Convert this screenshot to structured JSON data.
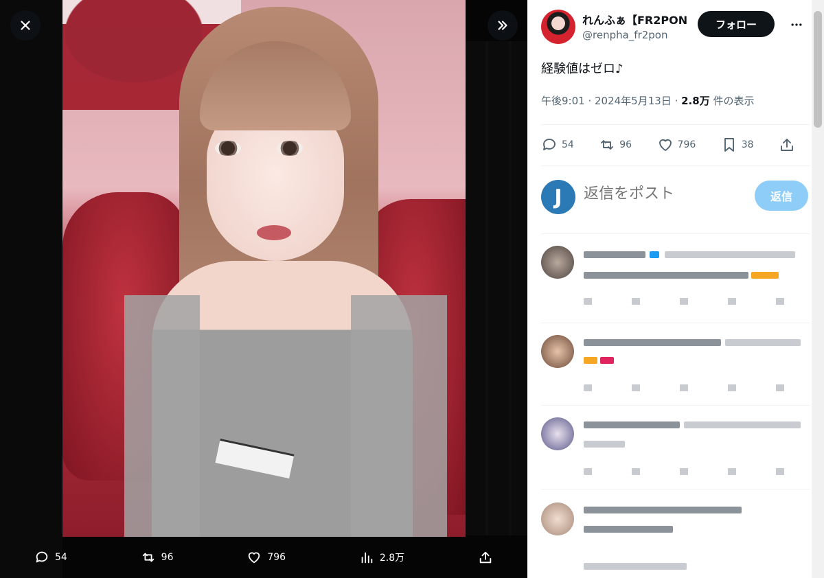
{
  "viewer": {
    "close_icon": "close-icon",
    "expand_icon": "chevron-double-right-icon",
    "actions": {
      "replies": "54",
      "reposts": "96",
      "likes": "796",
      "views": "2.8万"
    }
  },
  "tweet": {
    "author_name": "れんふぁ【FR2PON",
    "author_handle": "@renpha_fr2pon",
    "follow_label": "フォロー",
    "text": "経験値はゼロ♪",
    "time": "午後9:01",
    "sep1": " · ",
    "date": "2024年5月13日",
    "sep2": " · ",
    "views_count": "2.8万",
    "views_label": " 件の表示",
    "counts": {
      "replies": "54",
      "reposts": "96",
      "likes": "796",
      "bookmarks": "38"
    }
  },
  "composer": {
    "avatar_letter": "J",
    "placeholder": "返信をポスト",
    "reply_label": "返信"
  },
  "colors": {
    "accent": "#1d9bf0",
    "reply_button_disabled": "#8ecdf8",
    "follow_button": "#0f1419",
    "muted_text": "#536471"
  }
}
